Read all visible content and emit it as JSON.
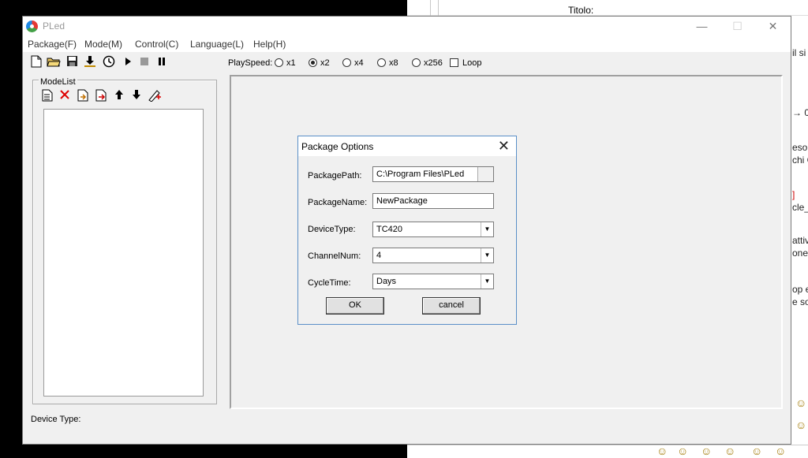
{
  "window": {
    "title": "PLed",
    "controls": {
      "minimize": "—",
      "maximize": "☐",
      "close": "✕"
    }
  },
  "menu": [
    "Package(F)",
    "Mode(M)",
    "Control(C)",
    "Language(L)",
    "Help(H)"
  ],
  "toolbar": {
    "icons": [
      "new-file-icon",
      "open-folder-icon",
      "save-icon",
      "download-icon",
      "timer-icon",
      "play-icon",
      "stop-icon",
      "pause-icon"
    ],
    "playspeed_label": "PlaySpeed:",
    "speeds": [
      {
        "label": "x1",
        "checked": false
      },
      {
        "label": "x2",
        "checked": true
      },
      {
        "label": "x4",
        "checked": false
      },
      {
        "label": "x8",
        "checked": false
      },
      {
        "label": "x256",
        "checked": false
      }
    ],
    "loop_label": "Loop",
    "loop_checked": false
  },
  "modelist": {
    "legend": "ModeList",
    "icons": [
      "add-mode-icon",
      "delete-icon",
      "import-icon",
      "export-icon",
      "move-up-icon",
      "move-down-icon",
      "edit-icon"
    ],
    "items": []
  },
  "status": {
    "device_type_label": "Device Type:"
  },
  "dialog": {
    "title": "Package Options",
    "fields": {
      "package_path": {
        "label": "PackagePath:",
        "value": "C:\\Program Files\\PLed"
      },
      "package_name": {
        "label": "PackageName:",
        "value": "NewPackage"
      },
      "device_type": {
        "label": "DeviceType:",
        "value": "TC420"
      },
      "channel_num": {
        "label": "ChannelNum:",
        "value": "4"
      },
      "cycle_time": {
        "label": "CycleTime:",
        "value": "Days"
      }
    },
    "ok_label": "OK",
    "cancel_label": "cancel"
  },
  "background": {
    "titolo": "Titolo:",
    "right_fragments": [
      "il si",
      "→ 0",
      "esou",
      "chi C",
      "]",
      "cle_",
      "attiv",
      "one",
      "op e",
      "e so"
    ]
  }
}
